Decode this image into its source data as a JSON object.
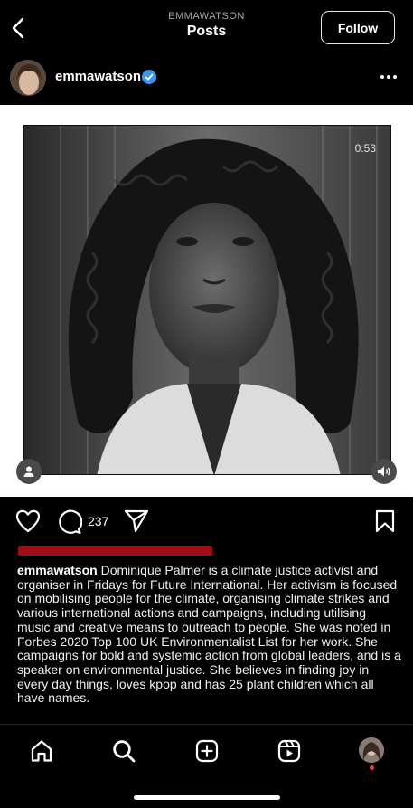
{
  "header": {
    "account_small": "EMMAWATSON",
    "title": "Posts",
    "follow_label": "Follow"
  },
  "post": {
    "username": "emmawatson",
    "verified": true,
    "video_time": "0:53",
    "comment_count": "237",
    "caption_username": "emmawatson",
    "caption_text": " Dominique Palmer is a climate justice activist and organiser in Fridays for Future International. Her activism is focused on mobilising people for the climate, organising climate strikes and various international actions and campaigns, including utilising music and creative means to outreach to people. She was noted in Forbes 2020 Top 100 UK Environmentalist List for her work. She campaigns for bold and systemic action from global leaders, and is a speaker on environmental justice. She believes in finding joy in every day things, loves kpop and has 25 plant children which all have names."
  },
  "icons": {
    "back": "chevron-left-icon",
    "verified": "verified-badge-icon",
    "more": "more-horizontal-icon",
    "like": "heart-icon",
    "comment": "comment-icon",
    "share": "paper-plane-icon",
    "save": "bookmark-icon",
    "home": "home-icon",
    "search": "search-icon",
    "create": "plus-square-icon",
    "reels": "reels-icon"
  },
  "colors": {
    "background": "#000000",
    "verified": "#3897f0",
    "notification_dot": "#ff3040"
  }
}
